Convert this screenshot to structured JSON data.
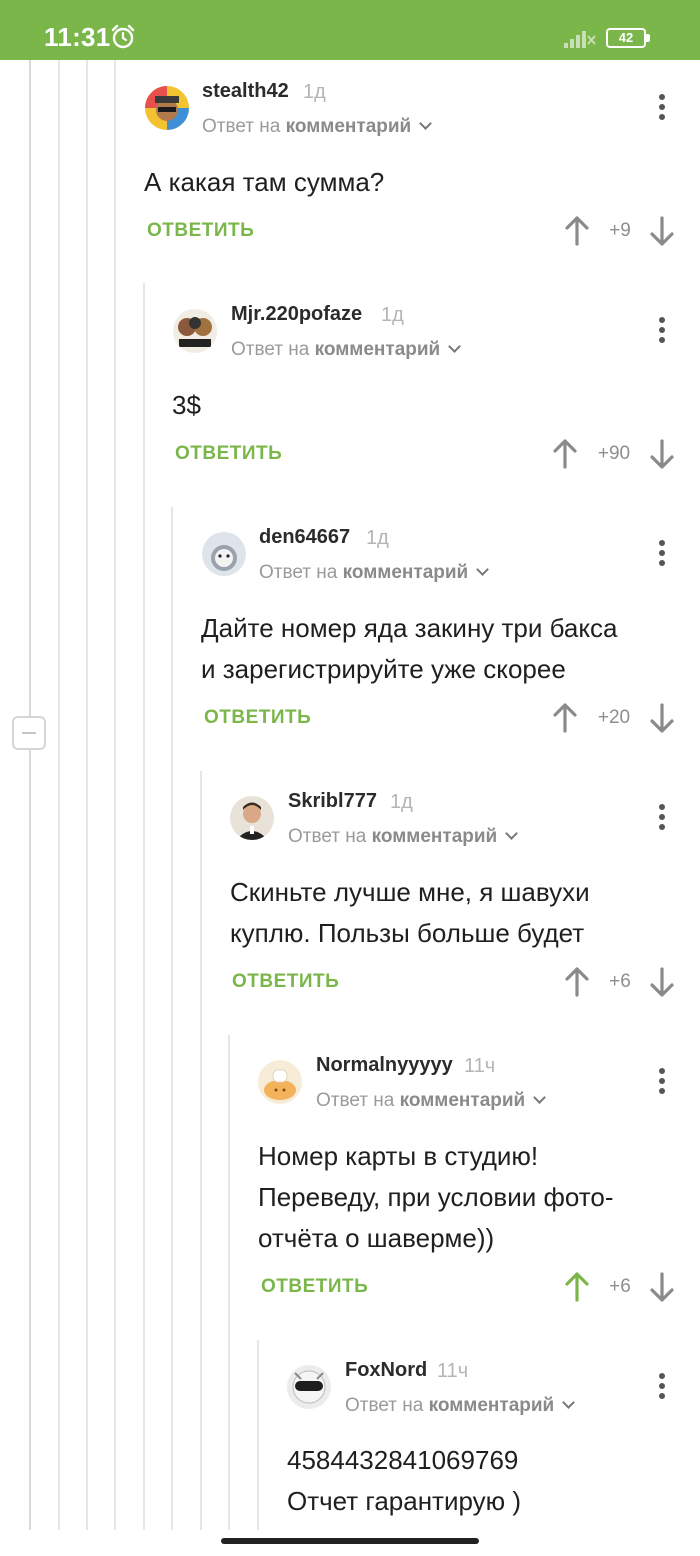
{
  "status_bar": {
    "time": "11:31",
    "battery": "42",
    "alarm_icon": "alarm-clock-icon",
    "signal_icon": "signal-off-icon"
  },
  "reply_button_label": "ОТВЕТИТЬ",
  "reply_to_prefix": "Ответ на",
  "reply_to_target": "комментарий",
  "comments": [
    {
      "username": "stealth42",
      "time": "1д",
      "text_lines": [
        "А какая там сумма?"
      ],
      "score": "+9",
      "upvoted": false
    },
    {
      "username": "Mjr.220pofaze",
      "time": "1д",
      "text_lines": [
        "3$"
      ],
      "score": "+90",
      "upvoted": false
    },
    {
      "username": "den64667",
      "time": "1д",
      "text_lines": [
        "Дайте номер яда закину три бакса",
        "и зарегистрируйте уже скорее"
      ],
      "score": "+20",
      "upvoted": false
    },
    {
      "username": "Skribl777",
      "time": "1д",
      "text_lines": [
        "Скиньте лучше мне, я шавухи",
        "куплю. Пользы больше будет"
      ],
      "score": "+6",
      "upvoted": false
    },
    {
      "username": "Normalnyyyyy",
      "time": "11ч",
      "text_lines": [
        "Номер карты в студию!",
        "Переведу, при условии фото-",
        "отчёта о шаверме))"
      ],
      "score": "+6",
      "upvoted": true
    },
    {
      "username": "FoxNord",
      "time": "11ч",
      "text_lines": [
        "4584432841069769",
        "Отчет гарантирую )"
      ],
      "score": null,
      "upvoted": false
    }
  ],
  "colors": {
    "accent": "#7bb64a",
    "upvoted_arrow": "#7bb64a",
    "arrow": "#8a8a8a"
  }
}
